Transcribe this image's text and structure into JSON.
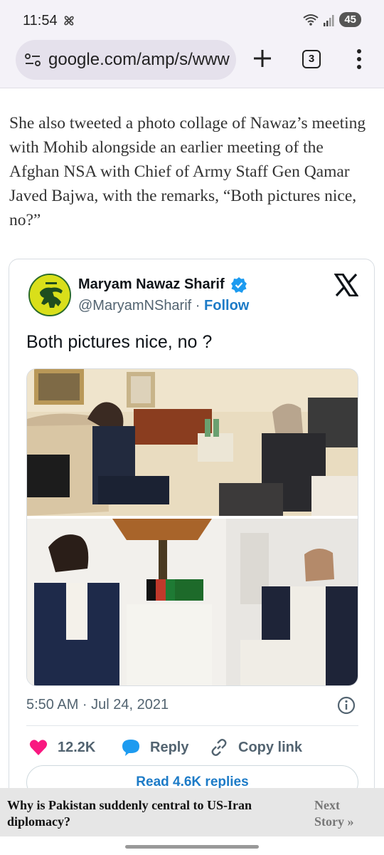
{
  "status_bar": {
    "time": "11:54",
    "battery": "45",
    "icons": [
      "fan-icon",
      "wifi-icon",
      "signal-icon"
    ]
  },
  "browser": {
    "url": "google.com/amp/s/www",
    "tab_count": "3",
    "icons": [
      "site-info-icon",
      "plus-icon",
      "tabs-icon",
      "more-vert-icon"
    ]
  },
  "article": {
    "paragraph": "She also tweeted a photo collage of Nawaz’s meeting with Mohib alongside an earlier meeting of the Afghan NSA with Chief of Army Staff Gen Qamar Javed Bajwa, with the remarks, “Both pictures nice, no?”"
  },
  "tweet": {
    "author_name": "Maryam Nawaz Sharif",
    "handle": "@MaryamNSharif",
    "separator": "·",
    "follow_label": "Follow",
    "text": "Both pictures nice, no ?",
    "timestamp": "5:50 AM · Jul 24, 2021",
    "likes": "12.2K",
    "reply_label": "Reply",
    "copy_link_label": "Copy link",
    "read_replies_label": "Read 4.6K replies",
    "colors": {
      "like": "#f91880",
      "reply": "#1d9bf0",
      "link": "#1d7bc7"
    }
  },
  "next_story": {
    "title": "Why is Pakistan suddenly central to US-Iran diplomacy?",
    "link_line1": "Next",
    "link_line2": "Story »"
  }
}
